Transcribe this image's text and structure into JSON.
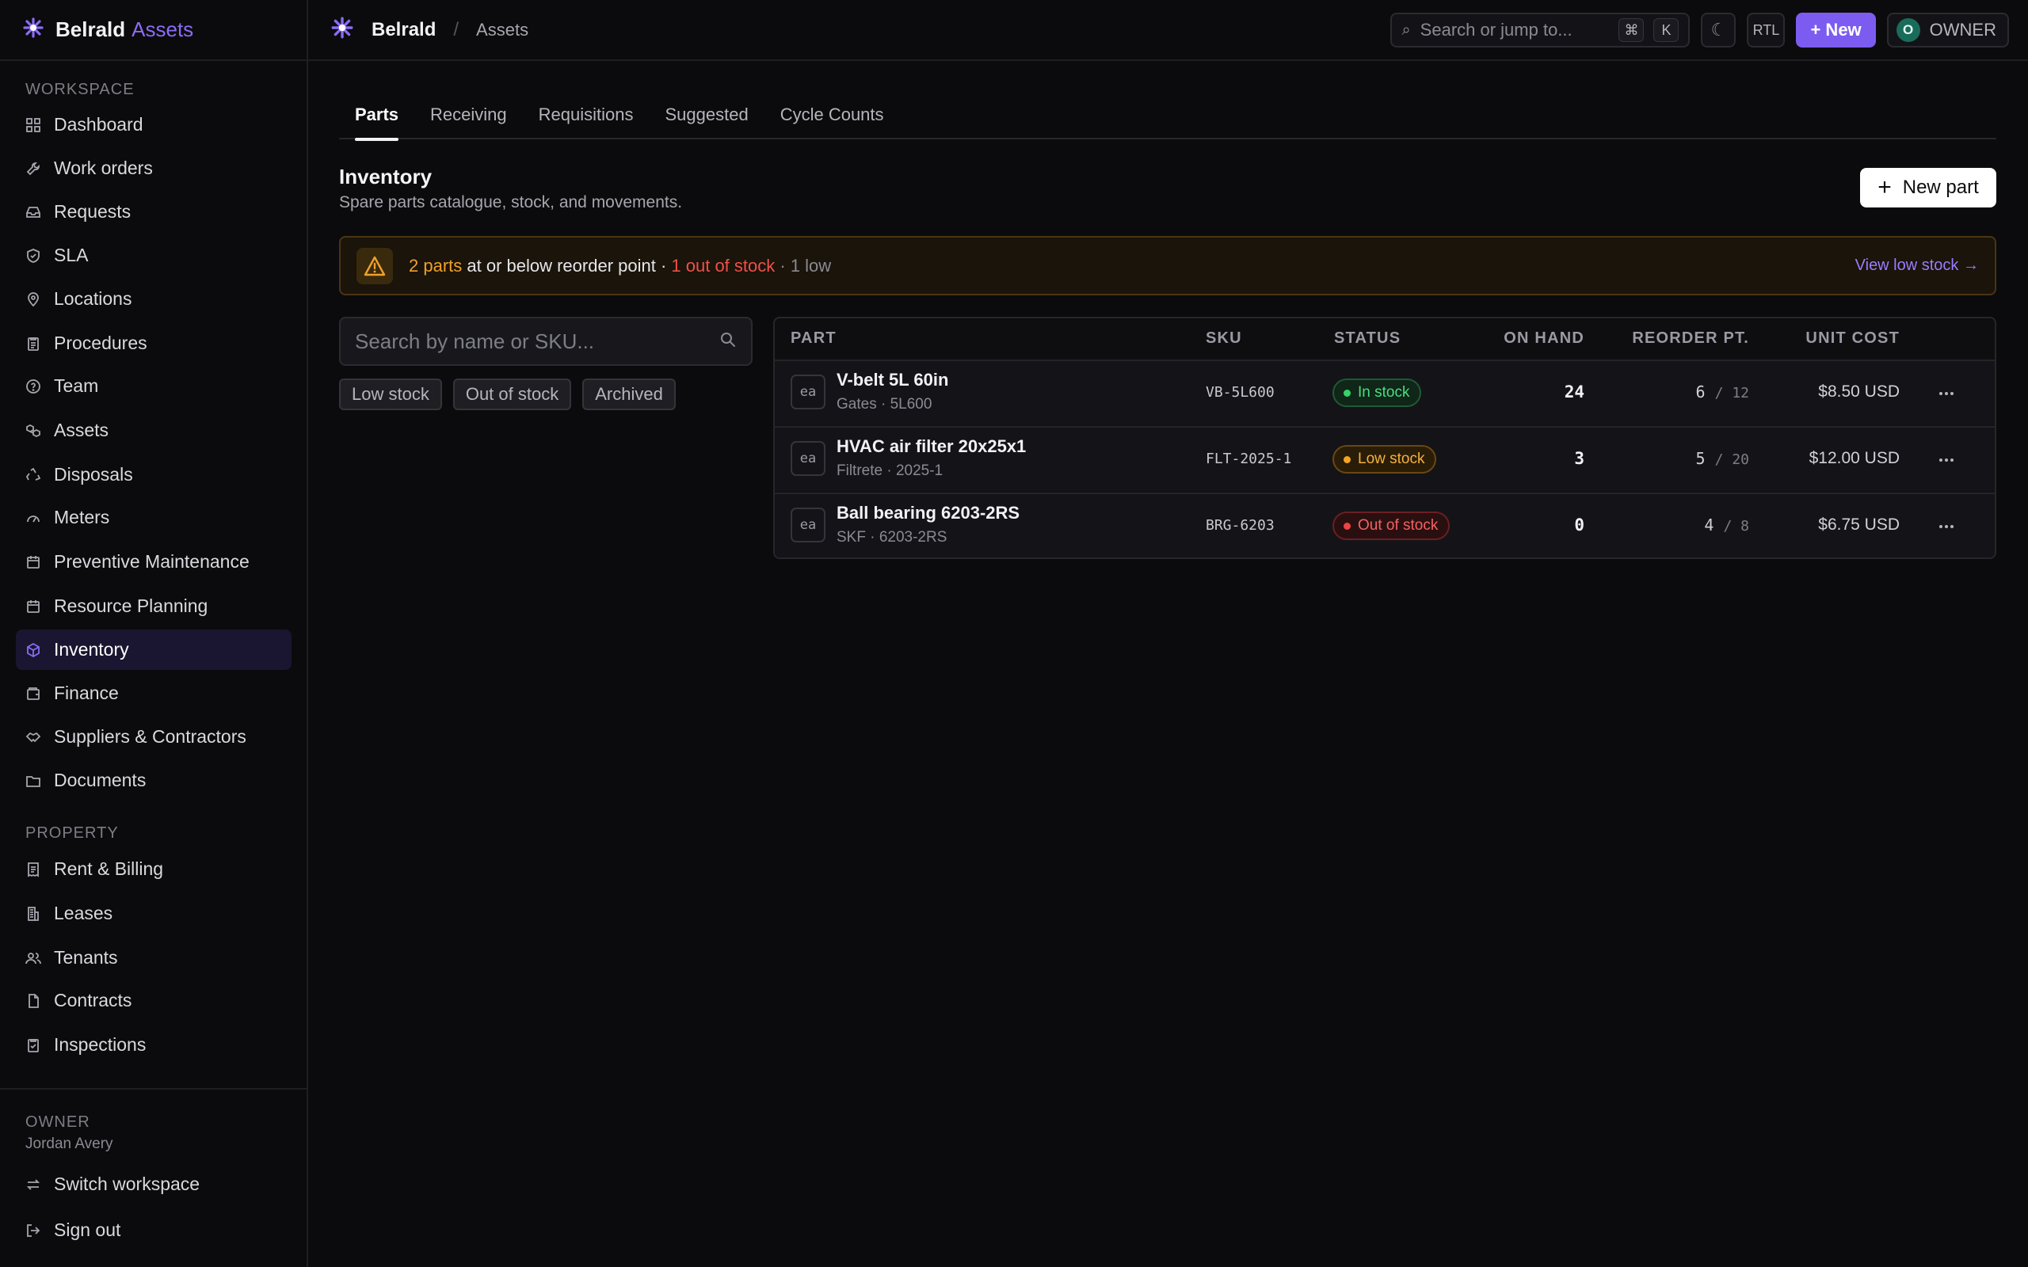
{
  "brand": {
    "name": "Belrald",
    "accent": "Assets"
  },
  "topbar": {
    "org": "Belrald",
    "separator": "/",
    "page": "Assets",
    "search_placeholder": "Search or jump to...",
    "kbd_cmd": "⌘",
    "kbd_k": "K",
    "rtl_label": "RTL",
    "new_label": "+ New",
    "owner_initial": "O",
    "owner_label": "OWNER"
  },
  "sidebar": {
    "workspace_label": "WORKSPACE",
    "workspace_items": [
      {
        "label": "Dashboard",
        "icon": "grid-icon"
      },
      {
        "label": "Work orders",
        "icon": "wrench-icon"
      },
      {
        "label": "Requests",
        "icon": "inbox-icon"
      },
      {
        "label": "SLA",
        "icon": "shield-icon"
      },
      {
        "label": "Locations",
        "icon": "map-pin-icon"
      },
      {
        "label": "Procedures",
        "icon": "clipboard-icon"
      },
      {
        "label": "Team",
        "icon": "help-circle-icon"
      },
      {
        "label": "Assets",
        "icon": "boxes-icon"
      },
      {
        "label": "Disposals",
        "icon": "recycle-icon"
      },
      {
        "label": "Meters",
        "icon": "gauge-icon"
      },
      {
        "label": "Preventive Maintenance",
        "icon": "calendar-icon"
      },
      {
        "label": "Resource Planning",
        "icon": "calendar-icon"
      },
      {
        "label": "Inventory",
        "icon": "package-icon",
        "active": true
      },
      {
        "label": "Finance",
        "icon": "wallet-icon"
      },
      {
        "label": "Suppliers & Contractors",
        "icon": "handshake-icon"
      },
      {
        "label": "Documents",
        "icon": "folder-icon"
      }
    ],
    "property_label": "PROPERTY",
    "property_items": [
      {
        "label": "Rent & Billing",
        "icon": "receipt-icon"
      },
      {
        "label": "Leases",
        "icon": "building-icon"
      },
      {
        "label": "Tenants",
        "icon": "users-icon"
      },
      {
        "label": "Contracts",
        "icon": "file-icon"
      },
      {
        "label": "Inspections",
        "icon": "clipboard-check-icon"
      }
    ],
    "footer": {
      "role": "OWNER",
      "user": "Jordan Avery",
      "switch_label": "Switch workspace",
      "signout_label": "Sign out"
    }
  },
  "main": {
    "tabs": [
      {
        "label": "Parts",
        "active": true
      },
      {
        "label": "Receiving"
      },
      {
        "label": "Requisitions"
      },
      {
        "label": "Suggested"
      },
      {
        "label": "Cycle Counts"
      }
    ],
    "title": "Inventory",
    "subtitle": "Spare parts catalogue, stock, and movements.",
    "new_part_label": "New part",
    "alert": {
      "parts_count": "2 parts",
      "text": " at or below reorder point · ",
      "out_of_stock": "1 out of stock",
      "low": " · 1 low",
      "link": "View low stock →"
    },
    "search_placeholder": "Search by name or SKU...",
    "chips": [
      "Low stock",
      "Out of stock",
      "Archived"
    ]
  },
  "table": {
    "headers": {
      "part": "PART",
      "sku": "SKU",
      "status": "STATUS",
      "on_hand": "ON HAND",
      "reorder": "REORDER PT.",
      "unit_cost": "UNIT COST"
    },
    "rows": [
      {
        "unit": "ea",
        "name": "V-belt 5L 60in",
        "meta": "Gates · 5L600",
        "sku": "VB-5L600",
        "status": "In stock",
        "status_color": "#4ade80",
        "on_hand": "24",
        "reorder": "6",
        "reorder_max": "/ 12",
        "cost": "$8.50 USD"
      },
      {
        "unit": "ea",
        "name": "HVAC air filter 20x25x1",
        "meta": "Filtrete · 2025-1",
        "sku": "FLT-2025-1",
        "status": "Low stock",
        "status_color": "#f5b040",
        "on_hand": "3",
        "reorder": "5",
        "reorder_max": "/ 20",
        "cost": "$12.00 USD"
      },
      {
        "unit": "ea",
        "name": "Ball bearing 6203-2RS",
        "meta": "SKF · 6203-2RS",
        "sku": "BRG-6203",
        "status": "Out of stock",
        "status_color": "#f26262",
        "on_hand": "0",
        "reorder": "4",
        "reorder_max": "/ 8",
        "cost": "$6.75 USD"
      }
    ]
  },
  "colors": {
    "accent": "#8b6cf6",
    "background": "#0b0b0d",
    "warning": "#f0a12a",
    "danger": "#f0504a"
  }
}
